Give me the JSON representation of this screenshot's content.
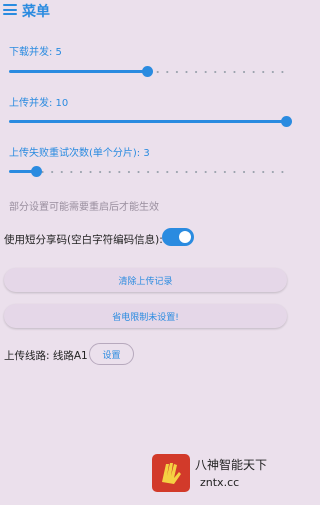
{
  "header": {
    "title": "菜单"
  },
  "settings": {
    "download_concurrency": {
      "label": "下载并发: 5",
      "value": 5,
      "max": 10
    },
    "upload_concurrency": {
      "label": "上传并发: 10",
      "value": 10,
      "max": 10
    },
    "retry_count": {
      "label": "上传失败重试次数(单个分片): 3",
      "value": 3,
      "max": 30
    },
    "note": "部分设置可能需要重启后才能生效",
    "short_share": {
      "label": "使用短分享码(空白字符编码信息):",
      "enabled": true
    },
    "clear_upload_button": "清除上传记录",
    "power_limit_button": "省电限制未设置!",
    "upload_route": {
      "label": "上传线路: 线路A1",
      "button": "设置"
    }
  },
  "watermark": {
    "line1": "八神智能天下",
    "line2": "zntx.cc"
  },
  "colors": {
    "accent": "#2a8be0",
    "background": "#ebe0ec",
    "watermark": "#d23a2a"
  }
}
